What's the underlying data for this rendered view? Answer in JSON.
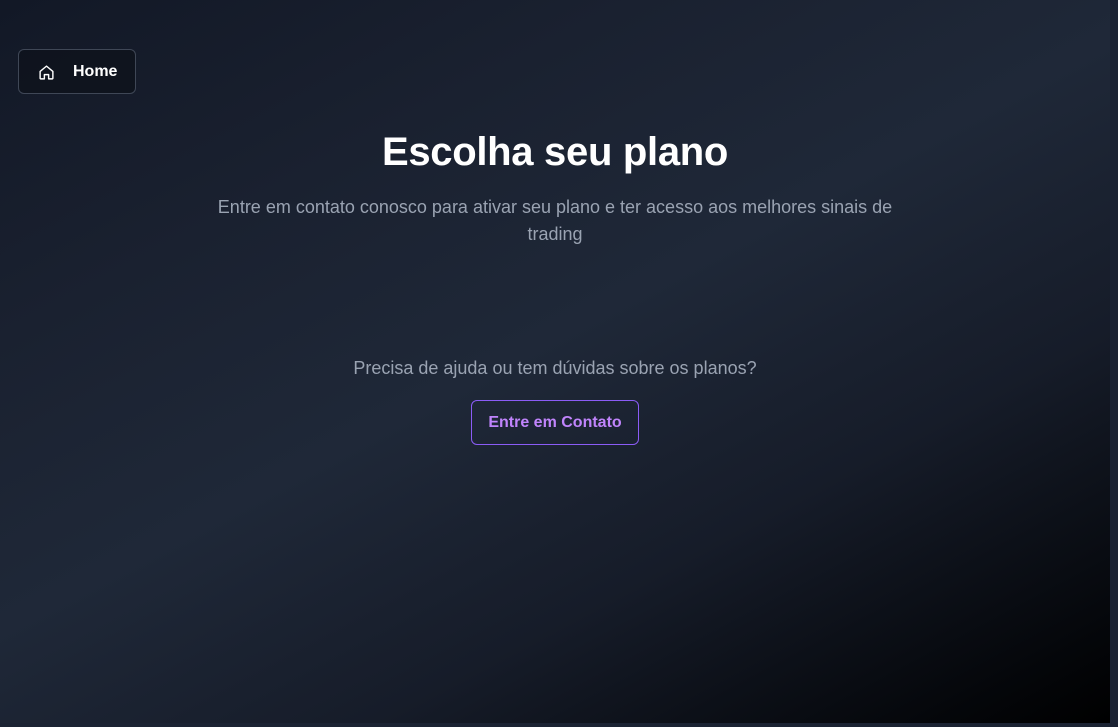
{
  "nav": {
    "home_label": "Home",
    "home_icon": "home-icon"
  },
  "header": {
    "title": "Escolha seu plano",
    "subtitle": "Entre em contato conosco para ativar seu plano e ter acesso aos melhores sinais de trading"
  },
  "help": {
    "text": "Precisa de ajuda ou tem dúvidas sobre os planos?",
    "contact_button_label": "Entre em Contato"
  },
  "colors": {
    "accent": "#a855f7",
    "background_top": "#1f2838",
    "background_corner": "#000000",
    "text_primary": "#ffffff",
    "text_muted": "#9aa3b2"
  }
}
